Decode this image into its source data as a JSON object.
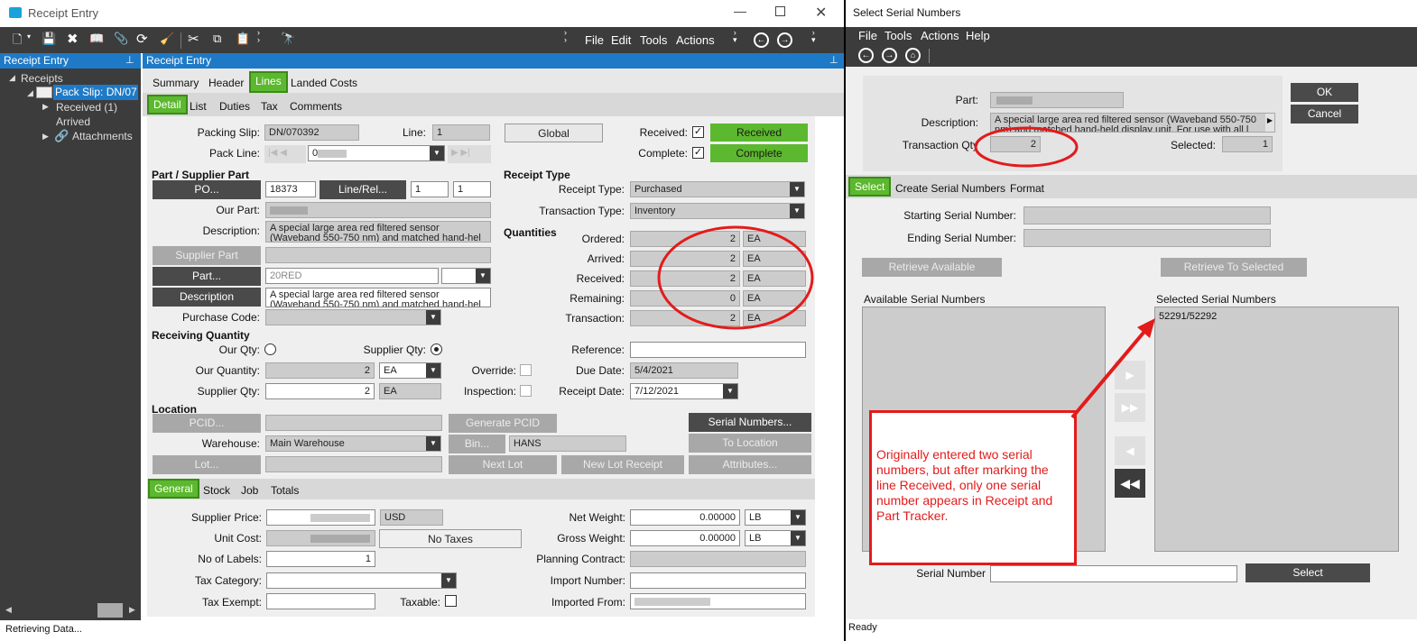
{
  "receipt_window": {
    "title": "Receipt Entry",
    "menus": [
      "File",
      "Edit",
      "Tools",
      "Actions"
    ],
    "tree": {
      "panel_title": "Receipt Entry",
      "root": "Receipts",
      "selected": "Pack Slip: DN/07",
      "child1": "Received (1)",
      "child1b": "Arrived",
      "child2": "Attachments"
    },
    "panel_title": "Receipt Entry",
    "top_tabs": [
      "Summary",
      "Header",
      "Lines",
      "Landed Costs"
    ],
    "sub_tabs": [
      "Detail",
      "List",
      "Duties",
      "Tax",
      "Comments"
    ],
    "packing_slip": {
      "label": "Packing Slip:",
      "value": "DN/070392"
    },
    "line": {
      "label": "Line:",
      "value": "1"
    },
    "pack_line": {
      "label": "Pack Line:",
      "value": "0"
    },
    "global_button": "Global",
    "received": {
      "label": "Received:",
      "button": "Received",
      "checked": "✓"
    },
    "complete": {
      "label": "Complete:",
      "button": "Complete",
      "checked": "✓"
    },
    "part_section": "Part / Supplier Part",
    "po_button": "PO...",
    "po_value": "18373",
    "line_rel_button": "Line/Rel...",
    "line_value": "1",
    "rel_value": "1",
    "our_part_label": "Our Part:",
    "description_label": "Description:",
    "description_value": "A special large area red filtered sensor (Waveband 550-750 nm) and matched hand-hel",
    "supplier_part_button": "Supplier Part",
    "part_button": "Part...",
    "part_value": "20RED",
    "description_button": "Description",
    "description2_value": "A special large area red filtered sensor (Waveband 550-750 nm) and matched hand-hel",
    "purchase_code_label": "Purchase Code:",
    "receipt_type_section": "Receipt Type",
    "receipt_type": {
      "label": "Receipt Type:",
      "value": "Purchased"
    },
    "transaction_type": {
      "label": "Transaction Type:",
      "value": "Inventory"
    },
    "quantities_section": "Quantities",
    "quantities": [
      {
        "label": "Ordered:",
        "value": "2",
        "uom": "EA"
      },
      {
        "label": "Arrived:",
        "value": "2",
        "uom": "EA"
      },
      {
        "label": "Received:",
        "value": "2",
        "uom": "EA"
      },
      {
        "label": "Remaining:",
        "value": "0",
        "uom": "EA"
      },
      {
        "label": "Transaction:",
        "value": "2",
        "uom": "EA"
      }
    ],
    "receiving_quantity_section": "Receiving Quantity",
    "our_qty_label": "Our Qty:",
    "supplier_qty_radio_label": "Supplier Qty:",
    "our_quantity": {
      "label": "Our Quantity:",
      "value": "2",
      "uom": "EA"
    },
    "supplier_qty": {
      "label": "Supplier Qty:",
      "value": "2",
      "uom": "EA"
    },
    "override_label": "Override:",
    "inspection_label": "Inspection:",
    "reference_label": "Reference:",
    "due_date": {
      "label": "Due Date:",
      "value": "5/4/2021"
    },
    "receipt_date": {
      "label": "Receipt Date:",
      "value": "7/12/2021"
    },
    "location_section": "Location",
    "pcid_button": "PCID...",
    "generate_pcid_button": "Generate PCID",
    "serial_numbers_button": "Serial Numbers...",
    "warehouse": {
      "label": "Warehouse:",
      "value": "Main Warehouse"
    },
    "bin_button": "Bin...",
    "bin_value": "HANS",
    "to_location_button": "To Location",
    "lot_button": "Lot...",
    "next_lot_button": "Next Lot",
    "new_lot_receipt_button": "New Lot Receipt",
    "attributes_button": "Attributes...",
    "bottom_tabs": [
      "General",
      "Stock",
      "Job",
      "Totals"
    ],
    "supplier_price": {
      "label": "Supplier Price:",
      "currency": "USD"
    },
    "unit_cost_label": "Unit Cost:",
    "no_taxes_button": "No Taxes",
    "no_of_labels": {
      "label": "No of Labels:",
      "value": "1"
    },
    "tax_category_label": "Tax Category:",
    "tax_exempt_label": "Tax Exempt:",
    "taxable_label": "Taxable:",
    "net_weight": {
      "label": "Net Weight:",
      "value": "0.00000",
      "uom": "LB"
    },
    "gross_weight": {
      "label": "Gross Weight:",
      "value": "0.00000",
      "uom": "LB"
    },
    "planning_contract_label": "Planning Contract:",
    "import_number_label": "Import Number:",
    "imported_from_label": "Imported From:",
    "status_text": "Retrieving Data..."
  },
  "serial_window": {
    "title": "Select Serial Numbers",
    "menus": [
      "File",
      "Tools",
      "Actions",
      "Help"
    ],
    "part_label": "Part:",
    "description_label": "Description:",
    "description_value": "A special large area red filtered sensor (Waveband 550-750 nm) and matched hand-held display unit. For use with all l",
    "transaction_qty": {
      "label": "Transaction Qty",
      "value": "2"
    },
    "selected": {
      "label": "Selected:",
      "value": "1"
    },
    "ok_button": "OK",
    "cancel_button": "Cancel",
    "tabs": [
      "Select",
      "Create Serial Numbers",
      "Format"
    ],
    "starting_serial_label": "Starting Serial Number:",
    "ending_serial_label": "Ending Serial Number:",
    "retrieve_available_button": "Retrieve Available",
    "retrieve_to_selected_button": "Retrieve To Selected",
    "available_title": "Available Serial Numbers",
    "selected_title": "Selected Serial Numbers",
    "selected_items": [
      "52291/52292"
    ],
    "serial_number_label": "Serial Number",
    "select_button": "Select",
    "status_text": "Ready"
  },
  "annotation": {
    "text": "Originally entered two serial numbers, but after marking the line Received, only one serial number appears in Receipt and Part Tracker.",
    "color": "#e31b1b"
  },
  "colors": {
    "accent_green": "#5cb82e",
    "toolbar": "#3c3c3c",
    "panel_blue": "#1e7ac7"
  }
}
